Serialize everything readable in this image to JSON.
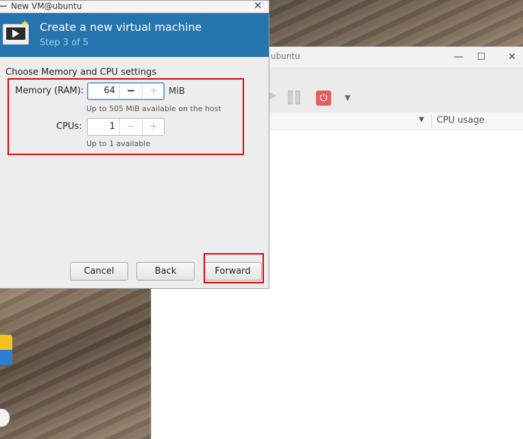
{
  "manager_window": {
    "title": "ubuntu",
    "columns": {
      "cpu_usage": "CPU usage"
    },
    "controls": {
      "minimize": "—",
      "maximize": "☐",
      "close": "✕"
    }
  },
  "dialog": {
    "title": "New VM@ubuntu",
    "close_label": "✕",
    "banner": {
      "title": "Create a new virtual machine",
      "step": "Step 3 of 5"
    },
    "section_label": "Choose Memory and CPU settings",
    "memory": {
      "label": "Memory (RAM):",
      "value": "64",
      "unit": "MiB",
      "hint": "Up to 505 MiB available on the host"
    },
    "cpus": {
      "label": "CPUs:",
      "value": "1",
      "hint": "Up to 1 available"
    },
    "buttons": {
      "cancel": "Cancel",
      "back": "Back",
      "forward": "Forward"
    }
  },
  "icons": {
    "minus": "−",
    "plus": "+",
    "sort": "▼",
    "dropdown": "▼",
    "power": "⏻",
    "star": "★"
  },
  "colors": {
    "banner": "#2674ad",
    "highlight": "#e00000",
    "power_button": "#e35d5d"
  }
}
